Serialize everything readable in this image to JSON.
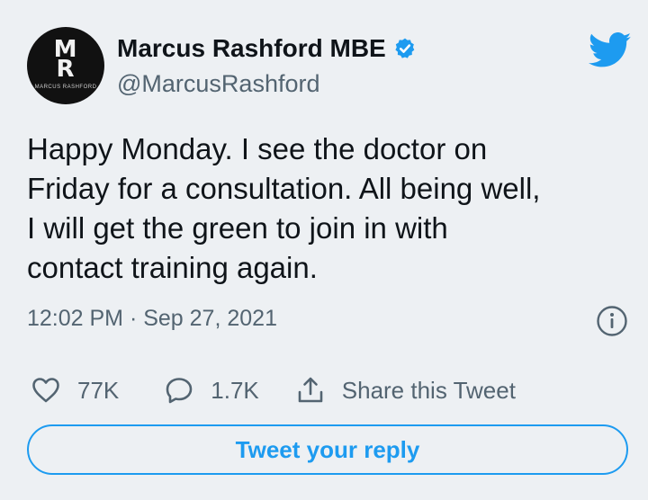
{
  "author": {
    "display_name": "Marcus Rashford MBE",
    "handle": "@MarcusRashford",
    "avatar": {
      "monogram_top": "M",
      "monogram_bottom": "R",
      "caption": "MARCUS RASHFORD"
    },
    "verified": true
  },
  "tweet": {
    "text": "Happy Monday. I see the doctor on\nFriday for a consultation. All being well,\nI will get the green to join in with\ncontact training again.",
    "timestamp": "12:02 PM · Sep 27, 2021"
  },
  "actions": {
    "like_count": "77K",
    "reply_count": "1.7K",
    "share_label": "Share this Tweet"
  },
  "reply_button": {
    "label": "Tweet your reply"
  },
  "icons": {
    "brand": "twitter-bird-icon",
    "verified": "verified-badge-icon",
    "info": "info-icon",
    "like": "heart-icon",
    "reply": "speech-bubble-icon",
    "share": "share-icon"
  },
  "colors": {
    "background": "#edf0f3",
    "accent": "#1d9bf0",
    "text_primary": "#0f1419",
    "text_secondary": "#536471"
  }
}
